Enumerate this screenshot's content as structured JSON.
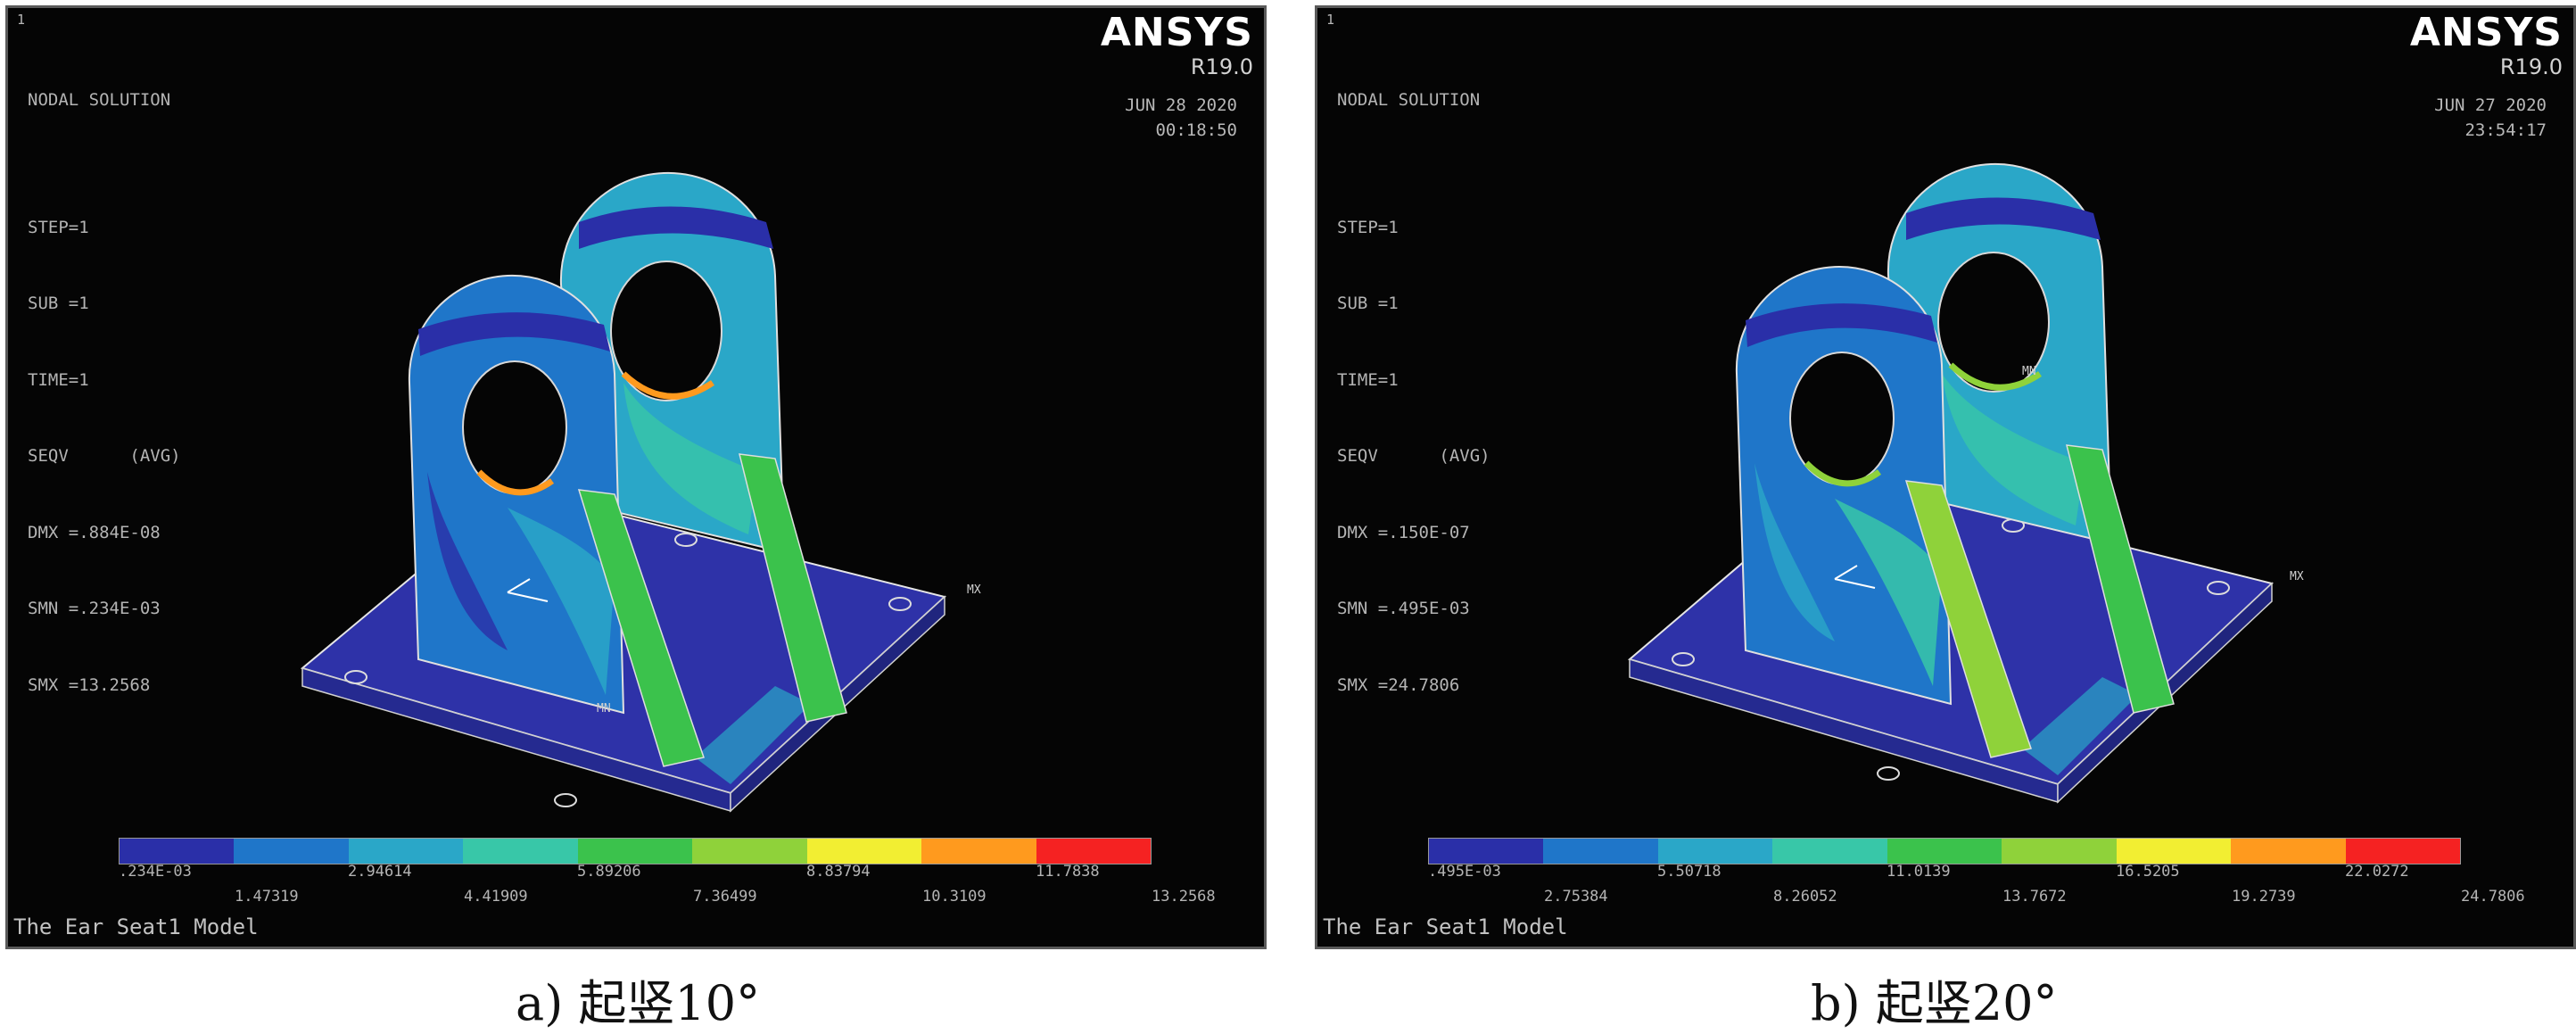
{
  "colors": {
    "background": "#050505",
    "contour": [
      "#2a2fa8",
      "#1f76c9",
      "#2aa7c8",
      "#38c7a8",
      "#3bc24c",
      "#8fd23a",
      "#f2ee32",
      "#ff9a1e",
      "#f52222"
    ]
  },
  "panels": [
    {
      "corner_number": "1",
      "info_lines": [
        "NODAL SOLUTION",
        "",
        "STEP=1",
        "SUB =1",
        "TIME=1",
        "SEQV      (AVG)",
        "DMX =.884E-08",
        "SMN =.234E-03",
        "SMX =13.2568"
      ],
      "brand": "ANSYS",
      "version": "R19.0",
      "date": "JUN 28 2020",
      "time": "00:18:50",
      "mx": "MX",
      "mn": "MN",
      "legend_top": [
        ".234E-03",
        "2.94614",
        "5.89206",
        "8.83794",
        "11.7838"
      ],
      "legend_bottom": [
        "1.47319",
        "4.41909",
        "7.36499",
        "10.3109",
        "13.2568"
      ],
      "model_title": "The Ear Seat1 Model",
      "caption": "a) 起竖10°"
    },
    {
      "corner_number": "1",
      "info_lines": [
        "NODAL SOLUTION",
        "",
        "STEP=1",
        "SUB =1",
        "TIME=1",
        "SEQV      (AVG)",
        "DMX =.150E-07",
        "SMN =.495E-03",
        "SMX =24.7806"
      ],
      "brand": "ANSYS",
      "version": "R19.0",
      "date": "JUN 27 2020",
      "time": "23:54:17",
      "mx": "MX",
      "mn": "MN",
      "legend_top": [
        ".495E-03",
        "5.50718",
        "11.0139",
        "16.5205",
        "22.0272"
      ],
      "legend_bottom": [
        "2.75384",
        "8.26052",
        "13.7672",
        "19.2739",
        "24.7806"
      ],
      "model_title": "The Ear Seat1 Model",
      "caption": "b) 起竖20°"
    }
  ]
}
